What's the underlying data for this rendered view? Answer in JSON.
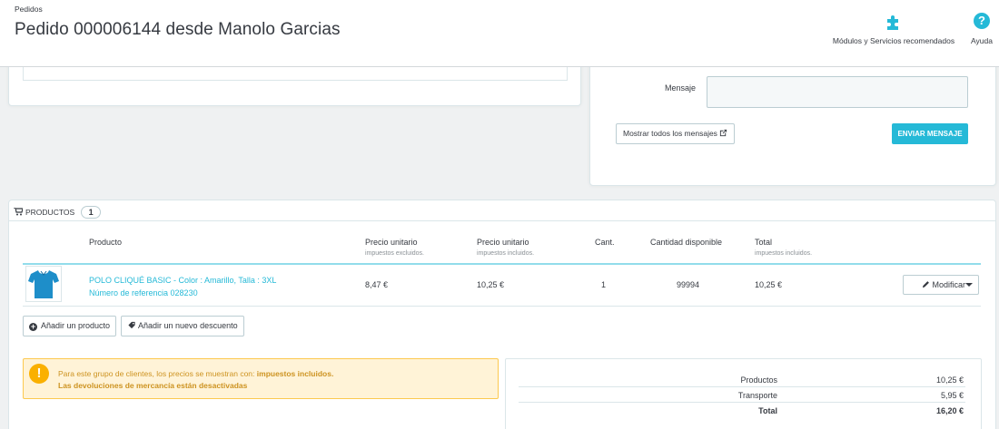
{
  "header": {
    "breadcrumb": "Pedidos",
    "title": "Pedido 000006144 desde Manolo Garcias",
    "modules_label": "Módulos y Servicios recomendados",
    "help_label": "Ayuda"
  },
  "messages": {
    "label": "Mensaje",
    "show_all": "Mostrar todos los mensajes",
    "send": "ENVIAR MENSAJE"
  },
  "products": {
    "heading": "PRODUCTOS",
    "count": "1",
    "columns": {
      "product": "Producto",
      "unit_price_excl": "Precio unitario",
      "unit_price_excl_sub": "impuestos excluidos.",
      "unit_price_incl": "Precio unitario",
      "unit_price_incl_sub": "impuestos incluidos.",
      "qty": "Cant.",
      "available": "Cantidad disponible",
      "total": "Total",
      "total_sub": "impuestos incluidos."
    },
    "rows": [
      {
        "name": "POLO CLIQUÉ BASIC - Color : Amarillo, Talla : 3XL",
        "reference": "Número de referencia 028230",
        "price_excl": "8,47 €",
        "price_incl": "10,25 €",
        "qty": "1",
        "available": "99994",
        "total": "10,25 €",
        "modify": "Modificar"
      }
    ],
    "add_product": "Añadir un producto",
    "add_discount": "Añadir un nuevo descuento"
  },
  "alert": {
    "line1": "Para este grupo de clientes, los precios se muestran con:",
    "line1_bold": "impuestos incluidos.",
    "line2": "Las devoluciones de mercancía están desactivadas"
  },
  "totals": {
    "products_label": "Productos",
    "products_value": "10,25 €",
    "shipping_label": "Transporte",
    "shipping_value": "5,95 €",
    "total_label": "Total",
    "total_value": "16,20 €"
  },
  "colors": {
    "accent": "#25b9d7",
    "warning_bg": "#fff3d7",
    "warning_text": "#cd9321"
  }
}
